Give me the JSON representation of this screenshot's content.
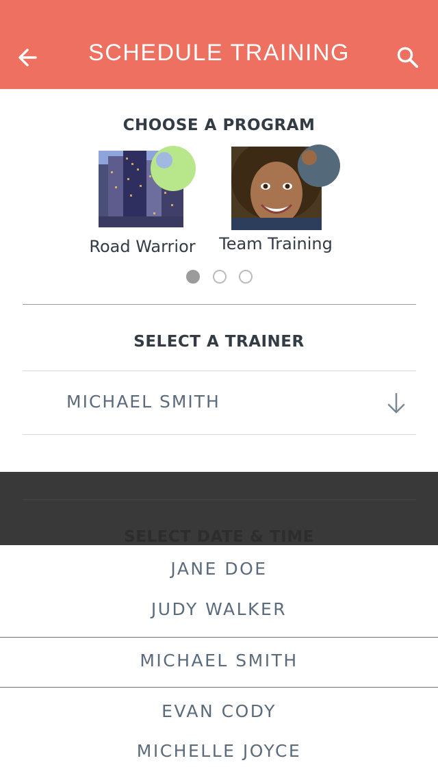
{
  "header": {
    "title": "SCHEDULE TRAINING",
    "bg_color": "#ee7061"
  },
  "program_section": {
    "heading": "CHOOSE A PROGRAM",
    "programs": [
      {
        "label": "Road Warrior",
        "image": "city-skyline",
        "badge_color": "#b8e68a",
        "badge_dot_color": "#a3b8e0"
      },
      {
        "label": "Team Training",
        "image": "smiling-woman-portrait",
        "badge_color": "#546a7b"
      }
    ],
    "pager": {
      "count": 3,
      "active_index": 0
    }
  },
  "trainer_section": {
    "heading": "SELECT A TRAINER",
    "selected": "MICHAEL SMITH",
    "dropdown_icon": "arrow-down-icon"
  },
  "date_section": {
    "heading": "SELECT DATE & TIME"
  },
  "picker": {
    "options": [
      "JANE DOE",
      "JUDY WALKER",
      "MICHAEL SMITH",
      "EVAN CODY",
      "MICHELLE JOYCE"
    ],
    "selected_index": 2
  }
}
